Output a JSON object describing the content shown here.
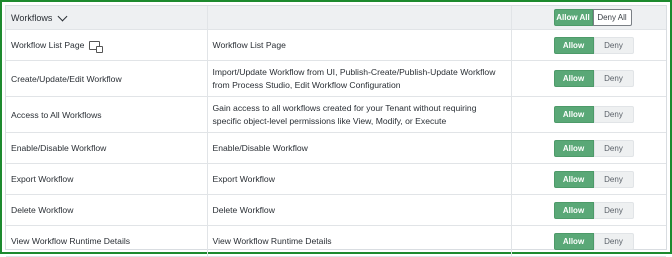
{
  "header": {
    "title": "Workflows",
    "allow_all_label": "Allow All",
    "deny_all_label": "Deny All"
  },
  "rows": [
    {
      "name": "Workflow List Page",
      "has_icon": true,
      "description": "Workflow List Page"
    },
    {
      "name": "Create/Update/Edit Workflow",
      "description": "Import/Update Workflow from UI, Publish-Create/Publish-Update Workflow from Process Studio, Edit Workflow Configuration"
    },
    {
      "name": "Access to All Workflows",
      "description": "Gain access to all workflows created for your Tenant without requiring specific object-level permissions like View, Modify, or Execute"
    },
    {
      "name": "Enable/Disable Workflow",
      "description": "Enable/Disable Workflow"
    },
    {
      "name": "Export Workflow",
      "description": "Export Workflow"
    },
    {
      "name": "Delete Workflow",
      "description": "Delete Workflow"
    },
    {
      "name": "View Workflow Runtime Details",
      "description": "View Workflow Runtime Details"
    }
  ],
  "buttons": {
    "allow_label": "Allow",
    "deny_label": "Deny"
  },
  "colors": {
    "frame_border": "#1d8a2e",
    "allow_bg": "#5aa877"
  }
}
